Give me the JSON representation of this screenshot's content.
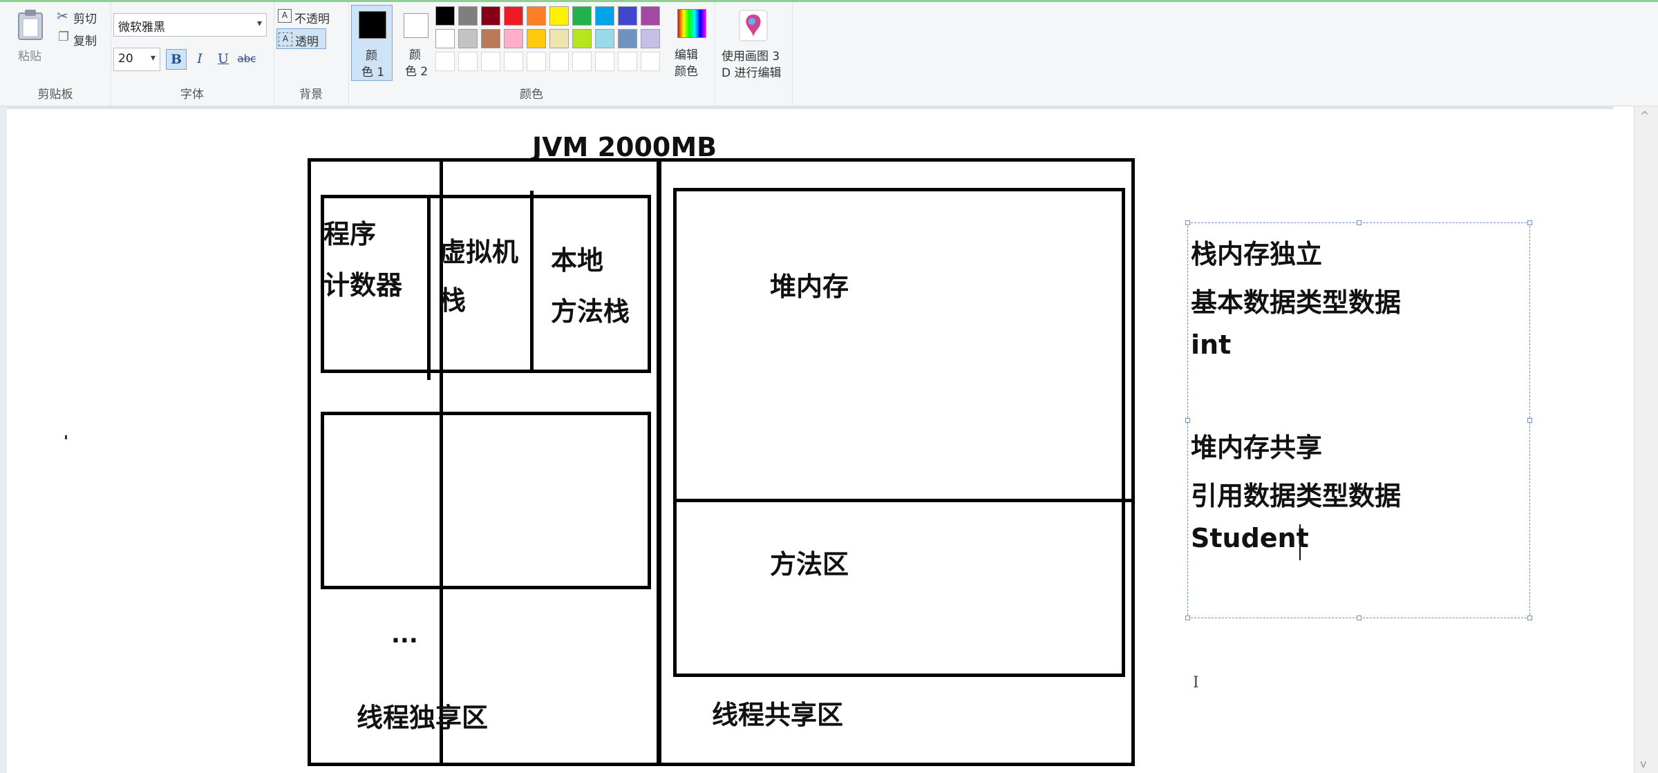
{
  "ribbon": {
    "clipboard": {
      "paste": "粘贴",
      "cut": "剪切",
      "copy": "复制",
      "group_label": "剪贴板"
    },
    "font": {
      "family": "微软雅黑",
      "size": "20",
      "bold": "B",
      "italic": "I",
      "underline": "U",
      "strike": "abc",
      "group_label": "字体"
    },
    "background": {
      "opaque": "不透明",
      "transparent": "透明",
      "group_label": "背景"
    },
    "colors": {
      "color1_line1": "颜",
      "color1_line2": "色 1",
      "color2_line1": "颜",
      "color2_line2": "色 2",
      "edit_line1": "编辑",
      "edit_line2": "颜色",
      "group_label": "颜色",
      "palette_row1": [
        "#000000",
        "#7f7f7f",
        "#880015",
        "#ed1c24",
        "#ff7f27",
        "#fff200",
        "#22b14c",
        "#00a2e8",
        "#3f48cc",
        "#a349a4"
      ],
      "palette_row2": [
        "#ffffff",
        "#c3c3c3",
        "#b97a57",
        "#ffaec9",
        "#ffc90e",
        "#efe4b0",
        "#b5e61d",
        "#99d9ea",
        "#7092be",
        "#c8bfe7"
      ]
    },
    "paint3d": {
      "line1": "使用画图 3",
      "line2": "D 进行编辑"
    }
  },
  "diagram": {
    "title": "JVM    2000MB",
    "program_counter_1": "程序",
    "program_counter_2": "计数器",
    "vm_stack_1": "虚拟机",
    "vm_stack_2": "栈",
    "native_stack_1": "本地",
    "native_stack_2": "方法栈",
    "ellipsis": "...",
    "thread_private": "线程独享区",
    "heap": "堆内存",
    "method_area": "方法区",
    "thread_shared": "线程共享区"
  },
  "textbox": {
    "lines": [
      "栈内存独立",
      "基本数据类型数据",
      "int",
      "",
      "堆内存共享",
      "引用数据类型数据",
      "Student"
    ]
  }
}
